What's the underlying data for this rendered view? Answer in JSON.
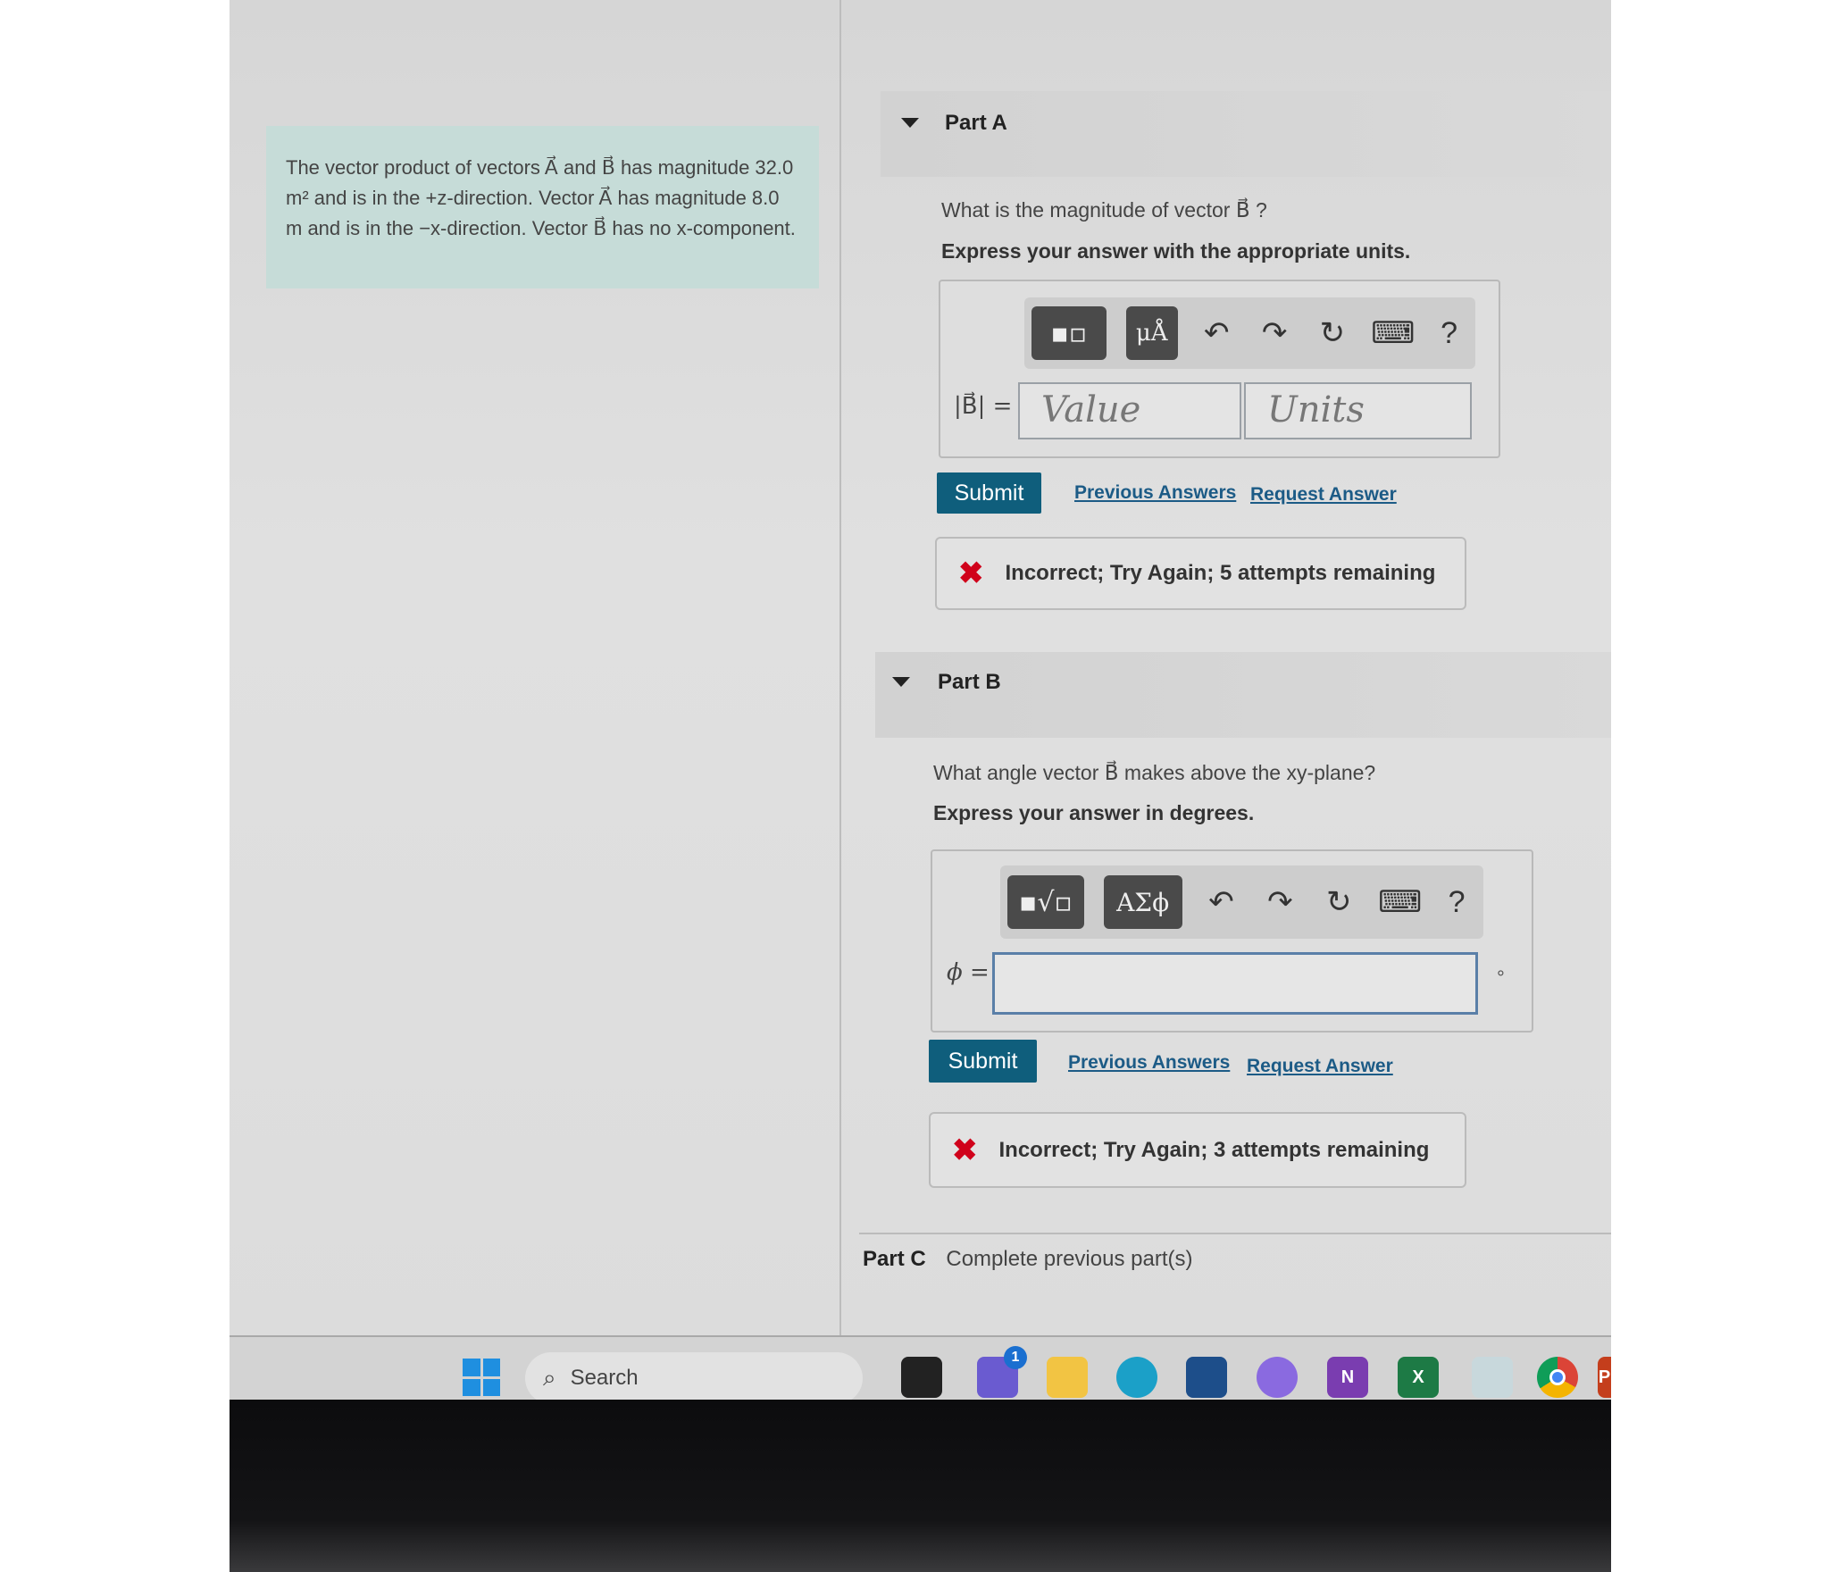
{
  "problem": {
    "text": "The vector product of vectors A⃗ and B⃗ has magnitude 32.0 m² and is in the +z-direction. Vector A⃗ has magnitude 8.0 m and is in the −x-direction. Vector B⃗ has no x-component."
  },
  "partA": {
    "title": "Part A",
    "question": "What is the magnitude of vector B⃗ ?",
    "instruction": "Express your answer with the appropriate units.",
    "label": "|B⃗| =",
    "value_placeholder": "Value",
    "units_placeholder": "Units",
    "tool1": "▪▫",
    "tool2": "μÅ",
    "submit": "Submit",
    "previous": "Previous Answers",
    "request": "Request Answer",
    "feedback": "Incorrect; Try Again; 5 attempts remaining"
  },
  "partB": {
    "title": "Part B",
    "question": "What angle vector B⃗ makes above the xy-plane?",
    "instruction": "Express your answer in degrees.",
    "label": "ϕ =",
    "value": "",
    "unit": "°",
    "tool1": "▪√▫",
    "tool2": "ΑΣϕ",
    "submit": "Submit",
    "previous": "Previous Answers",
    "request": "Request Answer",
    "feedback": "Incorrect; Try Again; 3 attempts remaining"
  },
  "partC": {
    "title": "Part C",
    "status": "Complete previous part(s)"
  },
  "toolbar": {
    "undo": "↶",
    "redo": "↷",
    "reset": "↻",
    "keyboard": "⌨",
    "help": "?"
  },
  "taskbar": {
    "search": "Search",
    "chat_badge": "1",
    "icons": [
      "task-view",
      "chat",
      "file-explorer",
      "edge",
      "store",
      "copilot",
      "onenote",
      "excel",
      "notepad",
      "chrome",
      "powerpoint"
    ]
  },
  "colors": {
    "submit": "#0f5e7c",
    "error": "#d0021b",
    "link": "#1c5b86",
    "problem_bg": "#c6dcd8"
  }
}
